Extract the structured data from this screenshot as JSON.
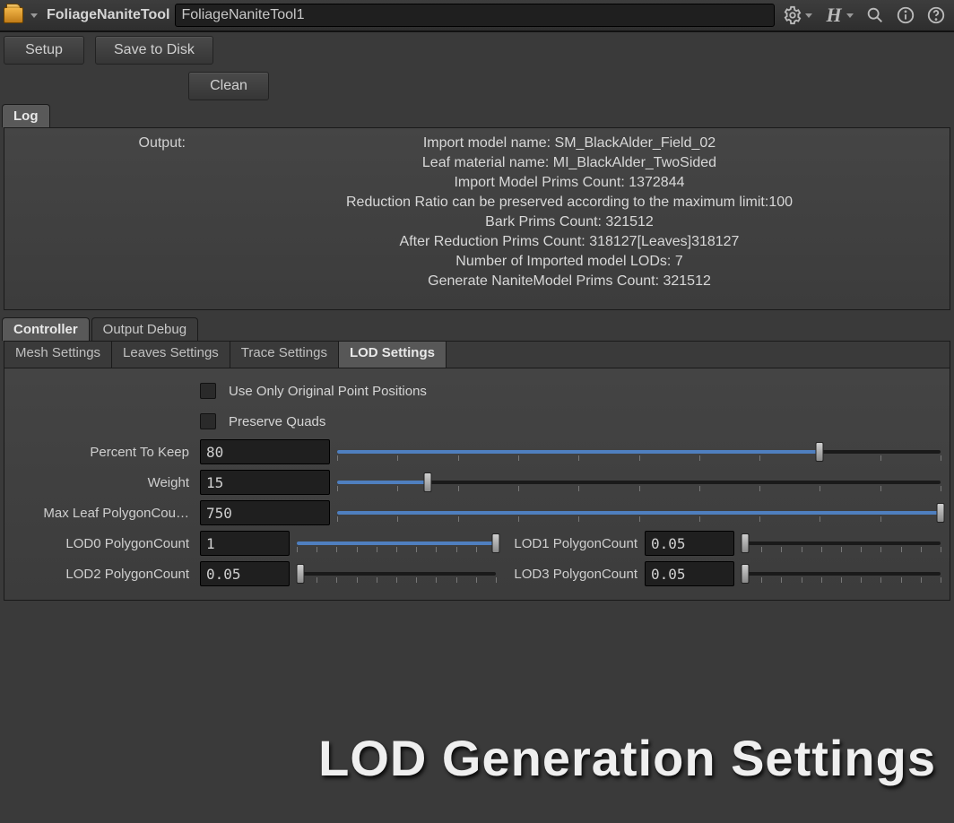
{
  "titlebar": {
    "node_type": "FoliageNaniteTool",
    "node_name": "FoliageNaniteTool1"
  },
  "buttons": {
    "setup": "Setup",
    "save": "Save to Disk",
    "clean": "Clean"
  },
  "log_tab": "Log",
  "log": {
    "label": "Output:",
    "lines": [
      "Import model name: SM_BlackAlder_Field_02",
      "Leaf material name: MI_BlackAlder_TwoSided",
      "Import Model Prims Count: 1372844",
      "Reduction Ratio can be preserved according to the maximum limit:100",
      "Bark Prims Count: 321512",
      "After Reduction Prims Count: 318127[Leaves]318127",
      "Number of Imported model LODs: 7",
      " Generate NaniteModel Prims Count: 321512"
    ]
  },
  "ctrl_tabs": {
    "controller": "Controller",
    "output_debug": "Output Debug"
  },
  "sub_tabs": {
    "mesh": "Mesh Settings",
    "leaves": "Leaves Settings",
    "trace": "Trace Settings",
    "lod": "LOD Settings"
  },
  "params": {
    "use_only_label": "Use Only Original Point Positions",
    "preserve_quads_label": "Preserve Quads",
    "percent_label": "Percent To Keep",
    "percent_value": "80",
    "percent_pct": 80,
    "weight_label": "Weight",
    "weight_value": "15",
    "weight_pct": 15,
    "maxleaf_label": "Max Leaf PolygonCou…",
    "maxleaf_value": "750",
    "maxleaf_pct": 100,
    "lod0_label": "LOD0 PolygonCount",
    "lod0_value": "1",
    "lod0_pct": 100,
    "lod1_label": "LOD1 PolygonCount",
    "lod1_value": "0.05",
    "lod1_pct": 2,
    "lod2_label": "LOD2 PolygonCount",
    "lod2_value": "0.05",
    "lod2_pct": 2,
    "lod3_label": "LOD3 PolygonCount",
    "lod3_value": "0.05",
    "lod3_pct": 2
  },
  "heading": "LOD Generation Settings"
}
